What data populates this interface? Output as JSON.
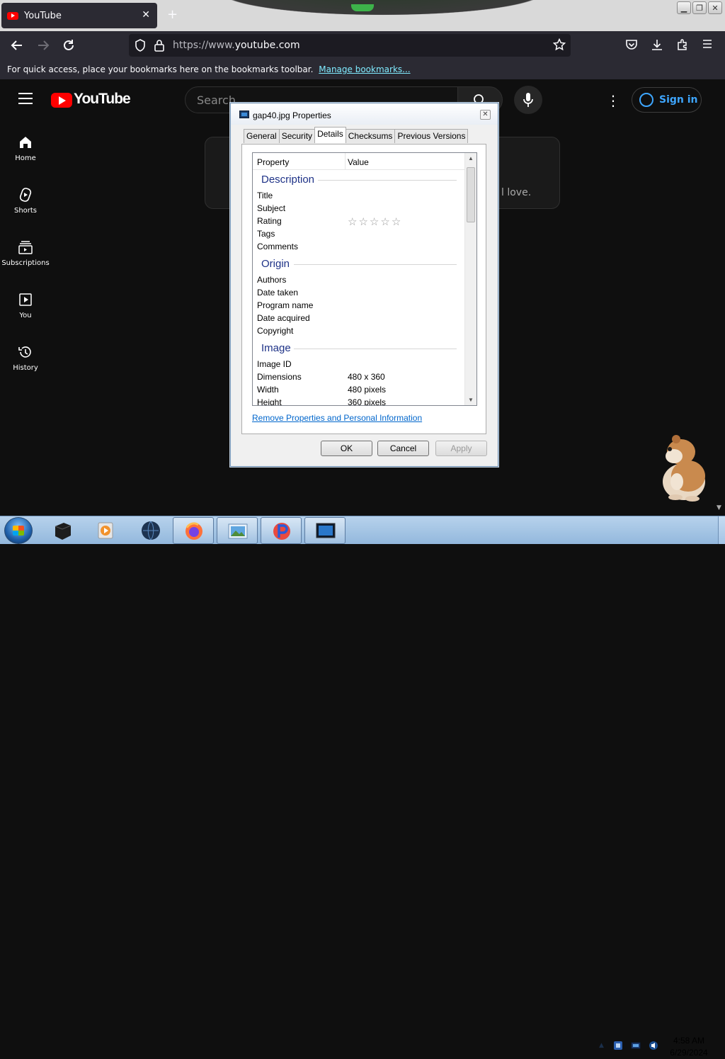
{
  "browser": {
    "tab_title": "YouTube",
    "tab_close": "✕",
    "new_tab": "+",
    "url_prefix": "https://www.",
    "url_domain": "youtube.com",
    "bookmarks_text": "For quick access, place your bookmarks here on the bookmarks toolbar.",
    "bookmarks_link": "Manage bookmarks..."
  },
  "youtube": {
    "logo_text": "YouTube",
    "search_placeholder": "Search",
    "sign_in": "Sign in",
    "sidebar": [
      {
        "label": "Home"
      },
      {
        "label": "Shorts"
      },
      {
        "label": "Subscriptions"
      },
      {
        "label": "You"
      },
      {
        "label": "History"
      }
    ],
    "promo_text_fragment": "l love."
  },
  "dialog": {
    "title": "gap40.jpg Properties",
    "tabs": [
      "General",
      "Security",
      "Details",
      "Checksums",
      "Previous Versions"
    ],
    "active_tab": "Details",
    "columns": {
      "property": "Property",
      "value": "Value"
    },
    "groups": {
      "description": "Description",
      "origin": "Origin",
      "image": "Image"
    },
    "description_rows": [
      "Title",
      "Subject",
      "Rating",
      "Tags",
      "Comments"
    ],
    "origin_rows": [
      "Authors",
      "Date taken",
      "Program name",
      "Date acquired",
      "Copyright"
    ],
    "image_rows": [
      {
        "prop": "Image ID",
        "value": ""
      },
      {
        "prop": "Dimensions",
        "value": "480 x 360"
      },
      {
        "prop": "Width",
        "value": "480 pixels"
      },
      {
        "prop": "Height",
        "value": "360 pixels"
      }
    ],
    "rating_stars": 0,
    "remove_link": "Remove Properties and Personal Information",
    "buttons": {
      "ok": "OK",
      "cancel": "Cancel",
      "apply": "Apply"
    }
  },
  "taskbar": {
    "time": "4:58 AM",
    "date": "6/29/2024"
  }
}
